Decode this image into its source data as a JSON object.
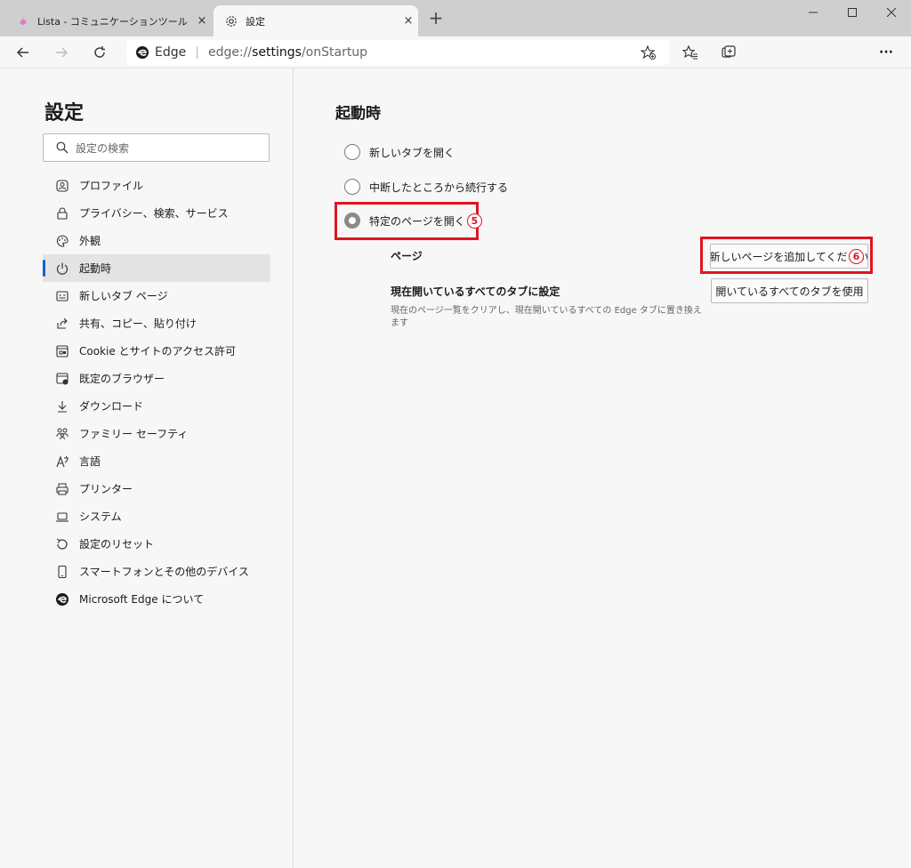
{
  "tabs": [
    {
      "title": "Lista - コミュニケーションツール",
      "close": "×"
    },
    {
      "title": "設定",
      "close": "×"
    }
  ],
  "new_tab": "+",
  "address": {
    "site_label": "Edge",
    "separator": "|",
    "url_prefix": "edge://",
    "url_bold": "settings",
    "url_suffix": "/onStartup"
  },
  "toolbar": {
    "more": "···"
  },
  "sidebar": {
    "title": "設定",
    "search_placeholder": "設定の検索",
    "items": [
      {
        "label": "プロファイル",
        "icon": "profile-icon"
      },
      {
        "label": "プライバシー、検索、サービス",
        "icon": "lock-icon"
      },
      {
        "label": "外観",
        "icon": "palette-icon"
      },
      {
        "label": "起動時",
        "icon": "power-icon"
      },
      {
        "label": "新しいタブ ページ",
        "icon": "new-tab-page-icon"
      },
      {
        "label": "共有、コピー、貼り付け",
        "icon": "share-icon"
      },
      {
        "label": "Cookie とサイトのアクセス許可",
        "icon": "cookie-icon"
      },
      {
        "label": "既定のブラウザー",
        "icon": "default-browser-icon"
      },
      {
        "label": "ダウンロード",
        "icon": "download-icon"
      },
      {
        "label": "ファミリー セーフティ",
        "icon": "family-icon"
      },
      {
        "label": "言語",
        "icon": "language-icon"
      },
      {
        "label": "プリンター",
        "icon": "printer-icon"
      },
      {
        "label": "システム",
        "icon": "system-icon"
      },
      {
        "label": "設定のリセット",
        "icon": "reset-icon"
      },
      {
        "label": "スマートフォンとその他のデバイス",
        "icon": "phone-icon"
      },
      {
        "label": "Microsoft Edge について",
        "icon": "edge-logo-icon"
      }
    ],
    "active_index": 3
  },
  "main": {
    "heading": "起動時",
    "options": [
      {
        "label": "新しいタブを開く",
        "selected": false
      },
      {
        "label": "中断したところから続行する",
        "selected": false
      },
      {
        "label": "特定のページを開く",
        "selected": true
      }
    ],
    "pages_label": "ページ",
    "add_page_button": "新しいページを追加してください",
    "use_all_tabs_title": "現在開いているすべてのタブに設定",
    "use_all_tabs_desc": "現在のページ一覧をクリアし、現在開いているすべての Edge タブに置き換えます",
    "use_all_tabs_button": "開いているすべてのタブを使用"
  },
  "annotations": {
    "mark5": "5",
    "mark6": "6",
    "color": "#e0151f"
  }
}
